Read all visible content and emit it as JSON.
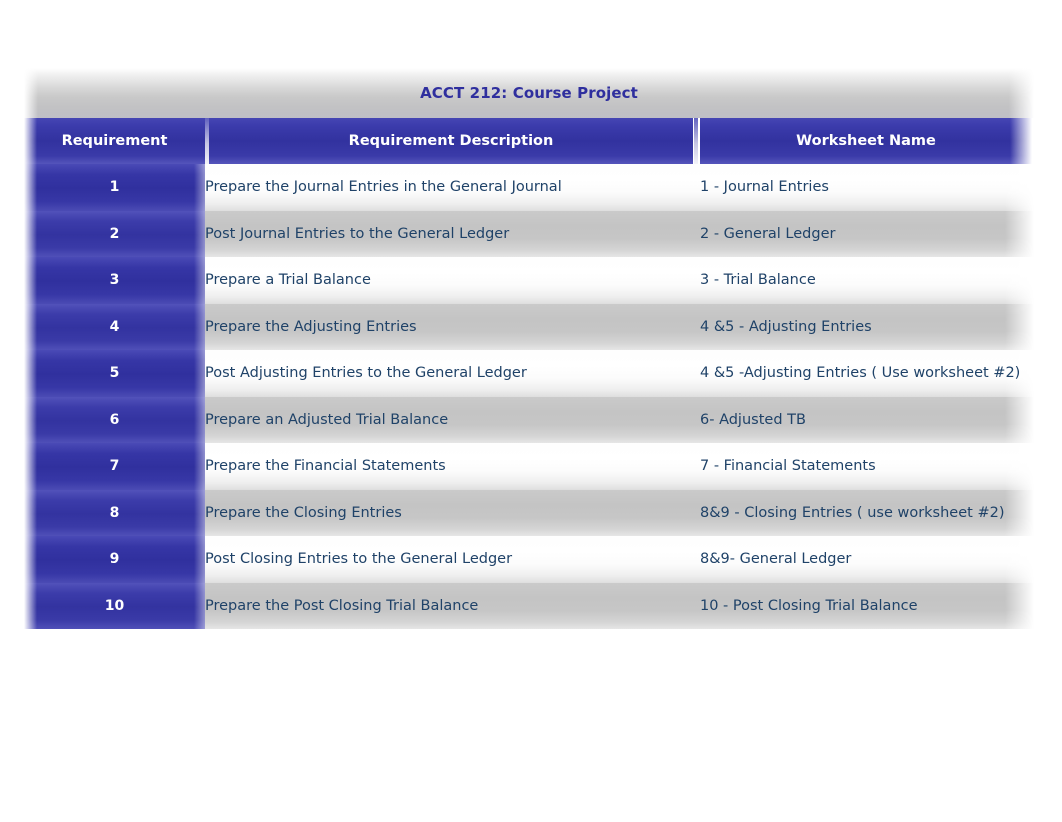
{
  "document": {
    "title": "ACCT 212: Course Project"
  },
  "table": {
    "columns": [
      {
        "key": "requirement",
        "label": "Requirement"
      },
      {
        "key": "description",
        "label": "Requirement Description"
      },
      {
        "key": "worksheet",
        "label": "Worksheet Name"
      }
    ],
    "rows": [
      {
        "requirement": "1",
        "description": "Prepare the Journal Entries in the General Journal",
        "worksheet": "1 - Journal Entries"
      },
      {
        "requirement": "2",
        "description": "Post Journal Entries to the General Ledger",
        "worksheet": "2 - General Ledger"
      },
      {
        "requirement": "3",
        "description": "Prepare a Trial Balance",
        "worksheet": "3 - Trial Balance"
      },
      {
        "requirement": "4",
        "description": "Prepare the Adjusting Entries",
        "worksheet": "4 &5 - Adjusting Entries"
      },
      {
        "requirement": "5",
        "description": "Post Adjusting Entries to the General Ledger",
        "worksheet": "4 &5 -Adjusting Entries ( Use worksheet #2)"
      },
      {
        "requirement": "6",
        "description": "Prepare an Adjusted Trial Balance",
        "worksheet": "6- Adjusted TB"
      },
      {
        "requirement": "7",
        "description": "Prepare the Financial Statements",
        "worksheet": "7 - Financial Statements"
      },
      {
        "requirement": "8",
        "description": "Prepare the Closing Entries",
        "worksheet": "8&9 - Closing Entries ( use worksheet #2)"
      },
      {
        "requirement": "9",
        "description": "Post Closing Entries to the General Ledger",
        "worksheet": "8&9- General Ledger"
      },
      {
        "requirement": "10",
        "description": "Prepare the Post Closing Trial Balance",
        "worksheet": "10 - Post Closing Trial Balance"
      }
    ]
  },
  "colors": {
    "header_blue": "#32329f",
    "title_text": "#2f2f9e",
    "body_text": "#1f4268",
    "row_light": "#ffffff",
    "row_dark": "#c4c4c4",
    "page_background": "#ffffff"
  }
}
